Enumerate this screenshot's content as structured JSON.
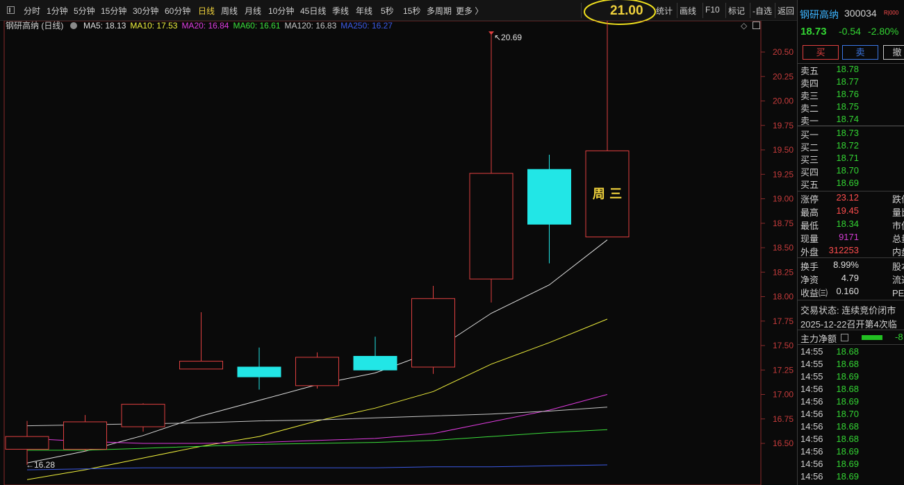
{
  "toolbar": {
    "periods": [
      "分时",
      "1分钟",
      "5分钟",
      "15分钟",
      "30分钟",
      "60分钟",
      "日线",
      "周线",
      "月线",
      "10分钟",
      "45日线",
      "季线",
      "年线",
      "5秒",
      "15秒",
      "多周期",
      "更多 〉"
    ],
    "active_period": "日线",
    "price_highlight": "21.00",
    "tools": [
      "统计",
      "画线",
      "F10",
      "标记",
      "-自选",
      "返回"
    ]
  },
  "chart": {
    "title": "钢研高纳 (日线)",
    "ma": [
      {
        "label": "MA5: 18.13",
        "color": "#e0e0e0"
      },
      {
        "label": "MA10: 17.53",
        "color": "#f0f03c"
      },
      {
        "label": "MA20: 16.84",
        "color": "#e03ce0"
      },
      {
        "label": "MA60: 16.61",
        "color": "#3ce03c"
      },
      {
        "label": "MA120: 16.83",
        "color": "#c8c8c8"
      },
      {
        "label": "MA250: 16.27",
        "color": "#3c5ae6"
      }
    ],
    "high_marker": "20.69",
    "low_marker": "16.28",
    "weekday_label": "周 三"
  },
  "chart_data": {
    "type": "candlestick",
    "y_ticks": [
      20.5,
      20.25,
      20.0,
      19.75,
      19.5,
      19.25,
      19.0,
      18.75,
      18.5,
      18.25,
      18.0,
      17.75,
      17.5,
      17.25,
      17.0,
      16.75,
      16.5
    ],
    "y_range": [
      16.3,
      20.7
    ],
    "candles": [
      {
        "open": 16.44,
        "close": 16.57,
        "high": 16.73,
        "low": 16.28,
        "color": "up"
      },
      {
        "open": 16.44,
        "close": 16.72,
        "high": 16.79,
        "low": 16.42,
        "color": "up"
      },
      {
        "open": 16.67,
        "close": 16.9,
        "high": 16.91,
        "low": 16.62,
        "color": "up"
      },
      {
        "open": 17.26,
        "close": 17.34,
        "high": 17.84,
        "low": 17.26,
        "color": "up"
      },
      {
        "open": 17.28,
        "close": 17.18,
        "high": 17.48,
        "low": 17.05,
        "color": "down"
      },
      {
        "open": 17.09,
        "close": 17.38,
        "high": 17.43,
        "low": 17.06,
        "color": "up"
      },
      {
        "open": 17.39,
        "close": 17.25,
        "high": 17.59,
        "low": 17.25,
        "color": "down"
      },
      {
        "open": 17.28,
        "close": 17.98,
        "high": 18.11,
        "low": 17.21,
        "color": "up"
      },
      {
        "open": 18.18,
        "close": 19.26,
        "high": 20.69,
        "low": 17.94,
        "color": "up"
      },
      {
        "open": 19.3,
        "close": 18.74,
        "high": 19.45,
        "low": 18.34,
        "color": "down"
      },
      {
        "open": 18.61,
        "close": 19.49,
        "high": 21.0,
        "low": 18.61,
        "color": "up"
      }
    ],
    "series": [
      {
        "name": "MA5",
        "color": "#e0e0e0",
        "values": [
          16.3,
          16.42,
          16.58,
          16.78,
          16.94,
          17.1,
          17.22,
          17.44,
          17.83,
          18.12,
          18.58
        ]
      },
      {
        "name": "MA10",
        "color": "#f0f03c",
        "values": [
          16.13,
          16.23,
          16.35,
          16.47,
          16.57,
          16.73,
          16.86,
          17.03,
          17.31,
          17.53,
          17.77
        ]
      },
      {
        "name": "MA20",
        "color": "#e03ce0",
        "values": [
          16.55,
          16.52,
          16.5,
          16.5,
          16.51,
          16.53,
          16.55,
          16.6,
          16.72,
          16.84,
          17.0
        ]
      },
      {
        "name": "MA60",
        "color": "#3ce03c",
        "values": [
          16.43,
          16.43,
          16.45,
          16.47,
          16.49,
          16.5,
          16.51,
          16.53,
          16.57,
          16.61,
          16.64
        ]
      },
      {
        "name": "MA120",
        "color": "#c8c8c8",
        "values": [
          16.68,
          16.69,
          16.7,
          16.71,
          16.73,
          16.74,
          16.76,
          16.78,
          16.8,
          16.83,
          16.87
        ]
      },
      {
        "name": "MA250",
        "color": "#3c5ae6",
        "values": [
          16.23,
          16.24,
          16.25,
          16.25,
          16.25,
          16.25,
          16.25,
          16.26,
          16.26,
          16.27,
          16.28
        ]
      }
    ]
  },
  "panel": {
    "stock_name": "钢研高纳",
    "stock_code": "300034",
    "tag": "R|000",
    "price": "18.73",
    "change": "-0.54",
    "change_pct": "-2.80%",
    "buttons": [
      "买",
      "卖",
      "撤"
    ],
    "asks": [
      {
        "label": "卖五",
        "price": "18.78"
      },
      {
        "label": "卖四",
        "price": "18.77"
      },
      {
        "label": "卖三",
        "price": "18.76"
      },
      {
        "label": "卖二",
        "price": "18.75"
      },
      {
        "label": "卖一",
        "price": "18.74"
      }
    ],
    "bids": [
      {
        "label": "买一",
        "price": "18.73"
      },
      {
        "label": "买二",
        "price": "18.72"
      },
      {
        "label": "买三",
        "price": "18.71"
      },
      {
        "label": "买四",
        "price": "18.70"
      },
      {
        "label": "买五",
        "price": "18.69"
      }
    ],
    "stats": [
      {
        "label": "涨停",
        "value": "23.12",
        "label2": "跌停",
        "color": "up"
      },
      {
        "label": "最高",
        "value": "19.45",
        "label2": "量比",
        "color": "up"
      },
      {
        "label": "最低",
        "value": "18.34",
        "label2": "市值",
        "color": "down"
      },
      {
        "label": "现量",
        "value": "9171",
        "label2": "总量",
        "color": "purple"
      },
      {
        "label": "外盘",
        "value": "312253",
        "label2": "内盘",
        "color": "up"
      }
    ],
    "stats2": [
      {
        "label": "换手",
        "value": "8.99%",
        "label2": "股本"
      },
      {
        "label": "净资",
        "value": "4.79",
        "label2": "流通"
      },
      {
        "label": "收益㈢",
        "value": "0.160",
        "label2": "PE(动"
      }
    ],
    "trade_status": "交易状态: 连续竞价闭市",
    "notice": "2025-12-22召开第4次临",
    "main_flow_label": "主力净额",
    "main_flow_value": "-8",
    "ticks": [
      {
        "time": "14:55",
        "price": "18.68"
      },
      {
        "time": "14:55",
        "price": "18.68"
      },
      {
        "time": "14:55",
        "price": "18.69"
      },
      {
        "time": "14:56",
        "price": "18.68"
      },
      {
        "time": "14:56",
        "price": "18.69"
      },
      {
        "time": "14:56",
        "price": "18.70"
      },
      {
        "time": "14:56",
        "price": "18.68"
      },
      {
        "time": "14:56",
        "price": "18.68"
      },
      {
        "time": "14:56",
        "price": "18.69"
      },
      {
        "time": "14:56",
        "price": "18.69"
      },
      {
        "time": "14:56",
        "price": "18.69"
      }
    ]
  }
}
